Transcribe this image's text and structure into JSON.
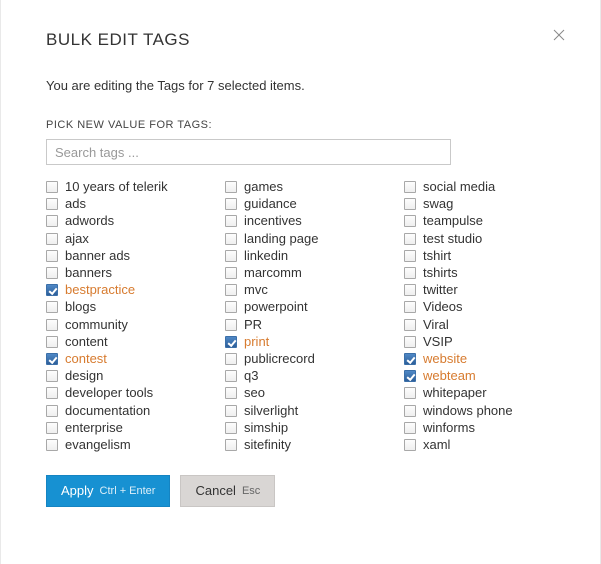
{
  "title": "BULK EDIT TAGS",
  "subhead": "You are editing the Tags for 7 selected items.",
  "section_label": "PICK NEW VALUE FOR TAGS:",
  "search": {
    "placeholder": "Search tags ...",
    "value": ""
  },
  "columns": [
    [
      {
        "label": "10 years of telerik",
        "checked": false
      },
      {
        "label": "ads",
        "checked": false
      },
      {
        "label": "adwords",
        "checked": false
      },
      {
        "label": "ajax",
        "checked": false
      },
      {
        "label": "banner ads",
        "checked": false
      },
      {
        "label": "banners",
        "checked": false
      },
      {
        "label": "bestpractice",
        "checked": true
      },
      {
        "label": "blogs",
        "checked": false
      },
      {
        "label": "community",
        "checked": false
      },
      {
        "label": "content",
        "checked": false
      },
      {
        "label": "contest",
        "checked": true
      },
      {
        "label": "design",
        "checked": false
      },
      {
        "label": "developer tools",
        "checked": false
      },
      {
        "label": "documentation",
        "checked": false
      },
      {
        "label": "enterprise",
        "checked": false
      },
      {
        "label": "evangelism",
        "checked": false
      }
    ],
    [
      {
        "label": "games",
        "checked": false
      },
      {
        "label": "guidance",
        "checked": false
      },
      {
        "label": "incentives",
        "checked": false
      },
      {
        "label": "landing page",
        "checked": false
      },
      {
        "label": "linkedin",
        "checked": false
      },
      {
        "label": "marcomm",
        "checked": false
      },
      {
        "label": "mvc",
        "checked": false
      },
      {
        "label": "powerpoint",
        "checked": false
      },
      {
        "label": "PR",
        "checked": false
      },
      {
        "label": "print",
        "checked": true
      },
      {
        "label": "publicrecord",
        "checked": false
      },
      {
        "label": "q3",
        "checked": false
      },
      {
        "label": "seo",
        "checked": false
      },
      {
        "label": "silverlight",
        "checked": false
      },
      {
        "label": "simship",
        "checked": false
      },
      {
        "label": "sitefinity",
        "checked": false
      }
    ],
    [
      {
        "label": "social media",
        "checked": false
      },
      {
        "label": "swag",
        "checked": false
      },
      {
        "label": "teampulse",
        "checked": false
      },
      {
        "label": "test studio",
        "checked": false
      },
      {
        "label": "tshirt",
        "checked": false
      },
      {
        "label": "tshirts",
        "checked": false
      },
      {
        "label": "twitter",
        "checked": false
      },
      {
        "label": "Videos",
        "checked": false
      },
      {
        "label": "Viral",
        "checked": false
      },
      {
        "label": "VSIP",
        "checked": false
      },
      {
        "label": "website",
        "checked": true
      },
      {
        "label": "webteam",
        "checked": true
      },
      {
        "label": "whitepaper",
        "checked": false
      },
      {
        "label": "windows phone",
        "checked": false
      },
      {
        "label": "winforms",
        "checked": false
      },
      {
        "label": "xaml",
        "checked": false
      }
    ]
  ],
  "buttons": {
    "apply": {
      "label": "Apply",
      "hint": "Ctrl + Enter"
    },
    "cancel": {
      "label": "Cancel",
      "hint": "Esc"
    }
  }
}
